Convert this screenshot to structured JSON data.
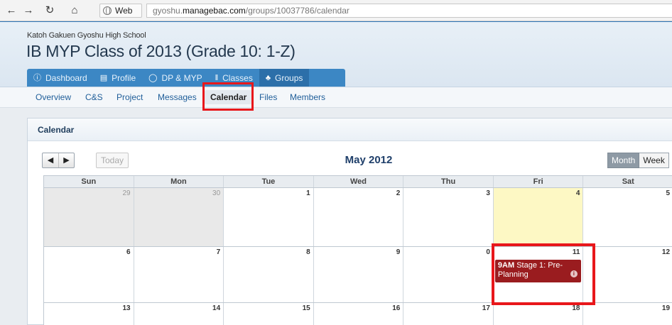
{
  "browser": {
    "back_icon": "arrow-left-icon",
    "forward_icon": "arrow-right-icon",
    "reload_icon": "reload-icon",
    "home_icon": "home-icon",
    "web_label": "Web",
    "url_prefix": "gyoshu.",
    "url_domain": "managebac.com",
    "url_path": "/groups/10037786/calendar"
  },
  "header": {
    "school": "Katoh Gakuen Gyoshu High School",
    "title": "IB MYP Class of 2013 (Grade 10: 1-Z)",
    "tabs": [
      {
        "label": "Dashboard",
        "icon": "info-icon"
      },
      {
        "label": "Profile",
        "icon": "id-card-icon"
      },
      {
        "label": "DP & MYP",
        "icon": "globe-icon"
      },
      {
        "label": "Classes",
        "icon": "books-icon"
      },
      {
        "label": "Groups",
        "icon": "trophy-icon"
      }
    ]
  },
  "subnav": {
    "items": [
      "Overview",
      "C&S",
      "Project",
      "Messages",
      "Calendar",
      "Files",
      "Members"
    ],
    "active": "Calendar"
  },
  "panel": {
    "title": "Calendar"
  },
  "calendar": {
    "today_label": "Today",
    "month_title": "May 2012",
    "views": [
      "Month",
      "Week"
    ],
    "active_view": "Month",
    "weekdays": [
      "Sun",
      "Mon",
      "Tue",
      "Wed",
      "Thu",
      "Fri",
      "Sat"
    ],
    "weeks": [
      [
        "29",
        "30",
        "1",
        "2",
        "3",
        "4",
        "5"
      ],
      [
        "6",
        "7",
        "8",
        "9",
        "0",
        "11",
        "12"
      ],
      [
        "13",
        "14",
        "15",
        "16",
        "17",
        "18",
        "19"
      ]
    ],
    "today_date": "4",
    "event": {
      "time": "9AM",
      "title": "Stage 1: Pre-Planning",
      "day": "11"
    }
  },
  "colors": {
    "accent_blue": "#3c87c4",
    "event_red": "#9a1c1f",
    "highlight_red": "#e8171b",
    "today_yellow": "#fdf8c4"
  }
}
